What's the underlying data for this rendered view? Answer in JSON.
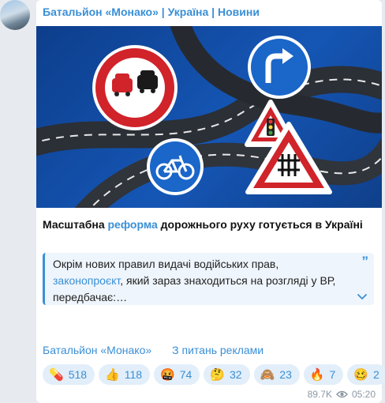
{
  "channel": {
    "title": "Батальйон «Монако» | Україна | Новини"
  },
  "post": {
    "headline": {
      "prefix": "Масштабна ",
      "link": "реформа",
      "suffix": " дорожнього руху готується в Україні"
    },
    "quote": {
      "line1": "Окрім нових правил видачі водійських прав,",
      "link": "законопроєкт",
      "line2_rest": ", який зараз знаходиться на розгляді у ВР,",
      "line3": "передбачає:…"
    }
  },
  "footer": {
    "author_link": "Батальйон «Монако»",
    "ads_link": "З питань реклами"
  },
  "reactions": [
    {
      "icon": "pill-icon",
      "emoji": "💊",
      "count": "518"
    },
    {
      "icon": "thumbs-up-icon",
      "emoji": "👍",
      "count": "118"
    },
    {
      "icon": "angry-face-icon",
      "emoji": "🤬",
      "count": "74"
    },
    {
      "icon": "thinking-face-icon",
      "emoji": "🤔",
      "count": "32"
    },
    {
      "icon": "see-no-evil-monkey-icon",
      "emoji": "🙈",
      "count": "23"
    },
    {
      "icon": "fire-icon",
      "emoji": "🔥",
      "count": "7"
    },
    {
      "icon": "woozy-face-icon",
      "emoji": "🥴",
      "count": "2"
    }
  ],
  "meta": {
    "views": "89.7K",
    "time": "05:20"
  },
  "colors": {
    "accent": "#3a8fd6",
    "quote_bg": "#eef5fc",
    "reaction_bg": "#e2eef9"
  }
}
